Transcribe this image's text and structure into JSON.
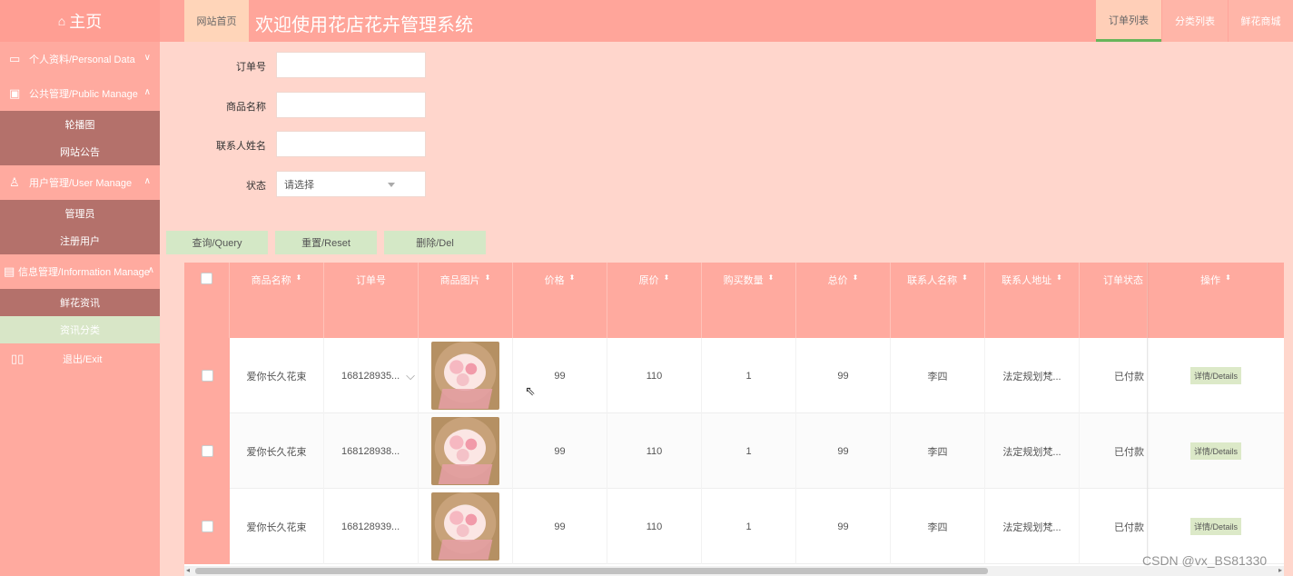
{
  "sidebar": {
    "home_label": "主页",
    "menus": [
      {
        "label": "个人资料/Personal Data",
        "icon": "id-card-icon",
        "chevron": "∨",
        "subs": []
      },
      {
        "label": "公共管理/Public Manage",
        "icon": "devices-icon",
        "chevron": "∧",
        "subs": [
          "轮播图",
          "网站公告"
        ]
      },
      {
        "label": "用户管理/User Manage",
        "icon": "user-icon",
        "chevron": "∧",
        "subs": [
          "管理员",
          "注册用户"
        ]
      },
      {
        "label": "信息管理/Information Manage",
        "icon": "document-icon",
        "chevron": "∧",
        "subs": [
          "鲜花资讯",
          "资讯分类"
        ]
      },
      {
        "label": "退出/Exit",
        "icon": "exit-icon",
        "chevron": "",
        "subs": []
      }
    ]
  },
  "topbar": {
    "site_home": "网站首页",
    "title": "欢迎使用花店花卉管理系统",
    "tabs": [
      "订单列表",
      "分类列表",
      "鲜花商城"
    ]
  },
  "search": {
    "fields": [
      {
        "label": "订单号",
        "value": ""
      },
      {
        "label": "商品名称",
        "value": ""
      },
      {
        "label": "联系人姓名",
        "value": ""
      },
      {
        "label": "状态",
        "value": "请选择"
      }
    ],
    "buttons": [
      "查询/Query",
      "重置/Reset",
      "删除/Del"
    ]
  },
  "table": {
    "columns": [
      "商品名称",
      "订单号",
      "商品图片",
      "价格",
      "原价",
      "购买数量",
      "总价",
      "联系人名称",
      "联系人地址",
      "订单状态",
      "操作"
    ],
    "rows": [
      {
        "name": "爱你长久花束",
        "order_no": "168128935...",
        "price": "99",
        "orig": "110",
        "qty": "1",
        "total": "99",
        "contact": "李四",
        "address": "法定规划梵...",
        "status": "已付款",
        "action": "详情/Details"
      },
      {
        "name": "爱你长久花束",
        "order_no": "168128938...",
        "price": "99",
        "orig": "110",
        "qty": "1",
        "total": "99",
        "contact": "李四",
        "address": "法定规划梵...",
        "status": "已付款",
        "action": "详情/Details"
      },
      {
        "name": "爱你长久花束",
        "order_no": "168128939...",
        "price": "99",
        "orig": "110",
        "qty": "1",
        "total": "99",
        "contact": "李四",
        "address": "法定规划梵...",
        "status": "已付款",
        "action": "详情/Details"
      }
    ]
  },
  "watermark": "CSDN @vx_BS81330"
}
